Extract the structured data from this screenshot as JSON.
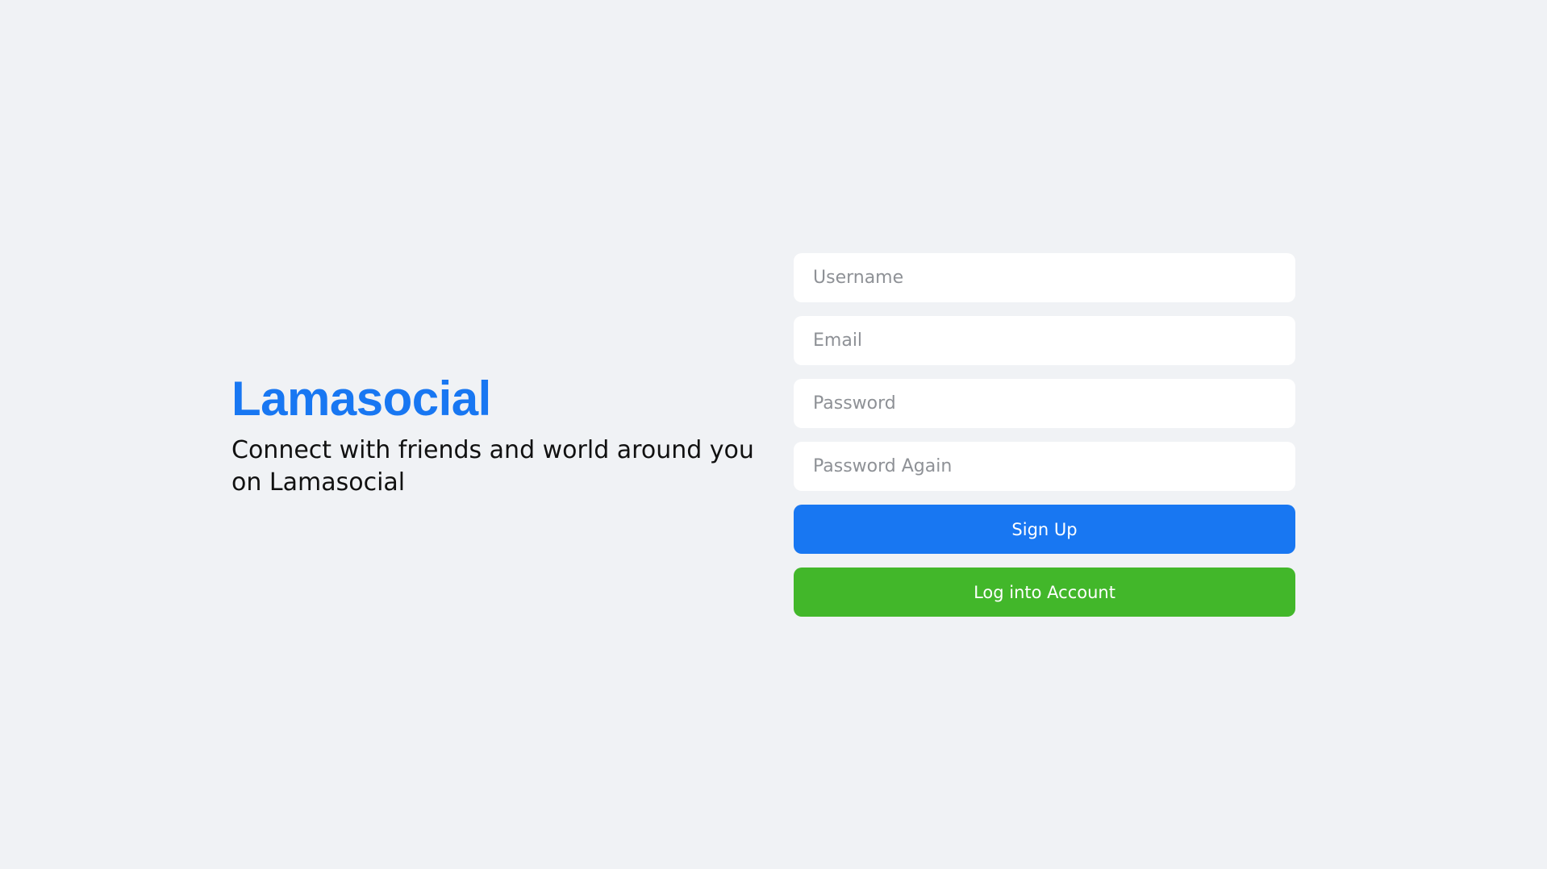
{
  "brand": {
    "logo": "Lamasocial",
    "tagline": "Connect with friends and world around you on Lamasocial"
  },
  "form": {
    "username_placeholder": "Username",
    "email_placeholder": "Email",
    "password_placeholder": "Password",
    "password_again_placeholder": "Password Again",
    "signup_label": "Sign Up",
    "login_label": "Log into Account"
  },
  "colors": {
    "background": "#f0f2f5",
    "accent": "#1877f2",
    "secondary": "#42b72a",
    "input_background": "#ffffff"
  }
}
